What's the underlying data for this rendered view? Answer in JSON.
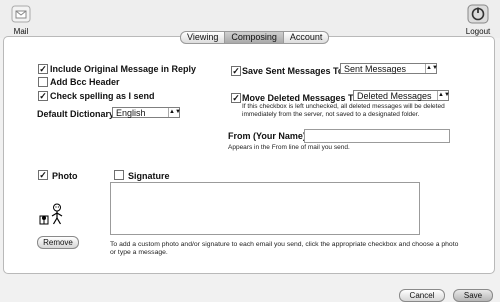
{
  "toolbar": {
    "mail_label": "Mail",
    "logout_label": "Logout"
  },
  "tabs": [
    {
      "label": "Viewing",
      "active": false
    },
    {
      "label": "Composing",
      "active": true
    },
    {
      "label": "Account",
      "active": false
    }
  ],
  "left_options": [
    {
      "label": "Include Original Message in Reply",
      "checked": true
    },
    {
      "label": "Add Bcc Header",
      "checked": false
    },
    {
      "label": "Check spelling as I send",
      "checked": true
    }
  ],
  "dictionary": {
    "label": "Default Dictionary:",
    "value": "English"
  },
  "sent": {
    "label": "Save Sent Messages To:",
    "checked": true,
    "value": "Sent Messages"
  },
  "deleted": {
    "label": "Move Deleted Messages To:",
    "checked": true,
    "value": "Deleted Messages",
    "note": "If this checkbox is left unchecked, all deleted messages will be deleted immediately from the server, not saved to a designated folder."
  },
  "from": {
    "label": "From (Your Name) :",
    "value": "",
    "note": "Appears in the From line of mail you send."
  },
  "photo": {
    "label": "Photo",
    "checked": true,
    "remove_label": "Remove"
  },
  "signature": {
    "label": "Signature",
    "checked": false,
    "value": "",
    "help": "To add a custom photo and/or signature to each email you send, click the appropriate checkbox and choose a photo or type a message."
  },
  "buttons": {
    "cancel_label": "Cancel",
    "save_label": "Save"
  },
  "check_glyph": "✓"
}
